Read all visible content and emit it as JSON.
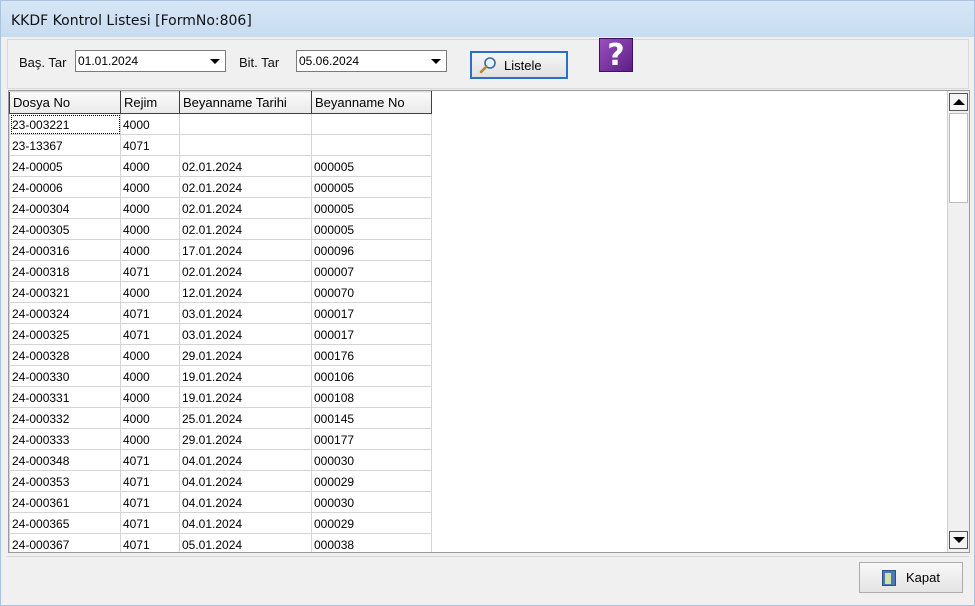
{
  "window": {
    "title": "KKDF Kontrol Listesi [FormNo:806]"
  },
  "filters": {
    "start_label": "Baş. Tar",
    "start_value": "01.01.2024",
    "end_label": "Bit. Tar",
    "end_value": "05.06.2024",
    "list_button": "Listele",
    "list_icon": "magnifier-icon",
    "help_icon": "help-icon",
    "help_glyph": "?"
  },
  "grid": {
    "columns": [
      "Dosya No",
      "Rejim",
      "Beyanname Tarihi",
      "Beyanname No"
    ],
    "rows": [
      [
        "23-003221",
        "4000",
        "",
        ""
      ],
      [
        "23-13367",
        "4071",
        "",
        ""
      ],
      [
        "24-00005",
        "4000",
        "02.01.2024",
        "000005"
      ],
      [
        "24-00006",
        "4000",
        "02.01.2024",
        "000005"
      ],
      [
        "24-000304",
        "4000",
        "02.01.2024",
        "000005"
      ],
      [
        "24-000305",
        "4000",
        "02.01.2024",
        "000005"
      ],
      [
        "24-000316",
        "4000",
        "17.01.2024",
        "000096"
      ],
      [
        "24-000318",
        "4071",
        "02.01.2024",
        "000007"
      ],
      [
        "24-000321",
        "4000",
        "12.01.2024",
        "000070"
      ],
      [
        "24-000324",
        "4071",
        "03.01.2024",
        "000017"
      ],
      [
        "24-000325",
        "4071",
        "03.01.2024",
        "000017"
      ],
      [
        "24-000328",
        "4000",
        "29.01.2024",
        "000176"
      ],
      [
        "24-000330",
        "4000",
        "19.01.2024",
        "000106"
      ],
      [
        "24-000331",
        "4000",
        "19.01.2024",
        "000108"
      ],
      [
        "24-000332",
        "4000",
        "25.01.2024",
        "000145"
      ],
      [
        "24-000333",
        "4000",
        "29.01.2024",
        "000177"
      ],
      [
        "24-000348",
        "4071",
        "04.01.2024",
        "000030"
      ],
      [
        "24-000353",
        "4071",
        "04.01.2024",
        "000029"
      ],
      [
        "24-000361",
        "4071",
        "04.01.2024",
        "000030"
      ],
      [
        "24-000365",
        "4071",
        "04.01.2024",
        "000029"
      ],
      [
        "24-000367",
        "4071",
        "05.01.2024",
        "000038"
      ]
    ]
  },
  "footer": {
    "close_button": "Kapat",
    "close_icon": "door-exit-icon"
  },
  "colors": {
    "title_bar": "#c8dcf1",
    "focus_border": "#2a6fc9",
    "help_purple": "#6a2a94"
  }
}
